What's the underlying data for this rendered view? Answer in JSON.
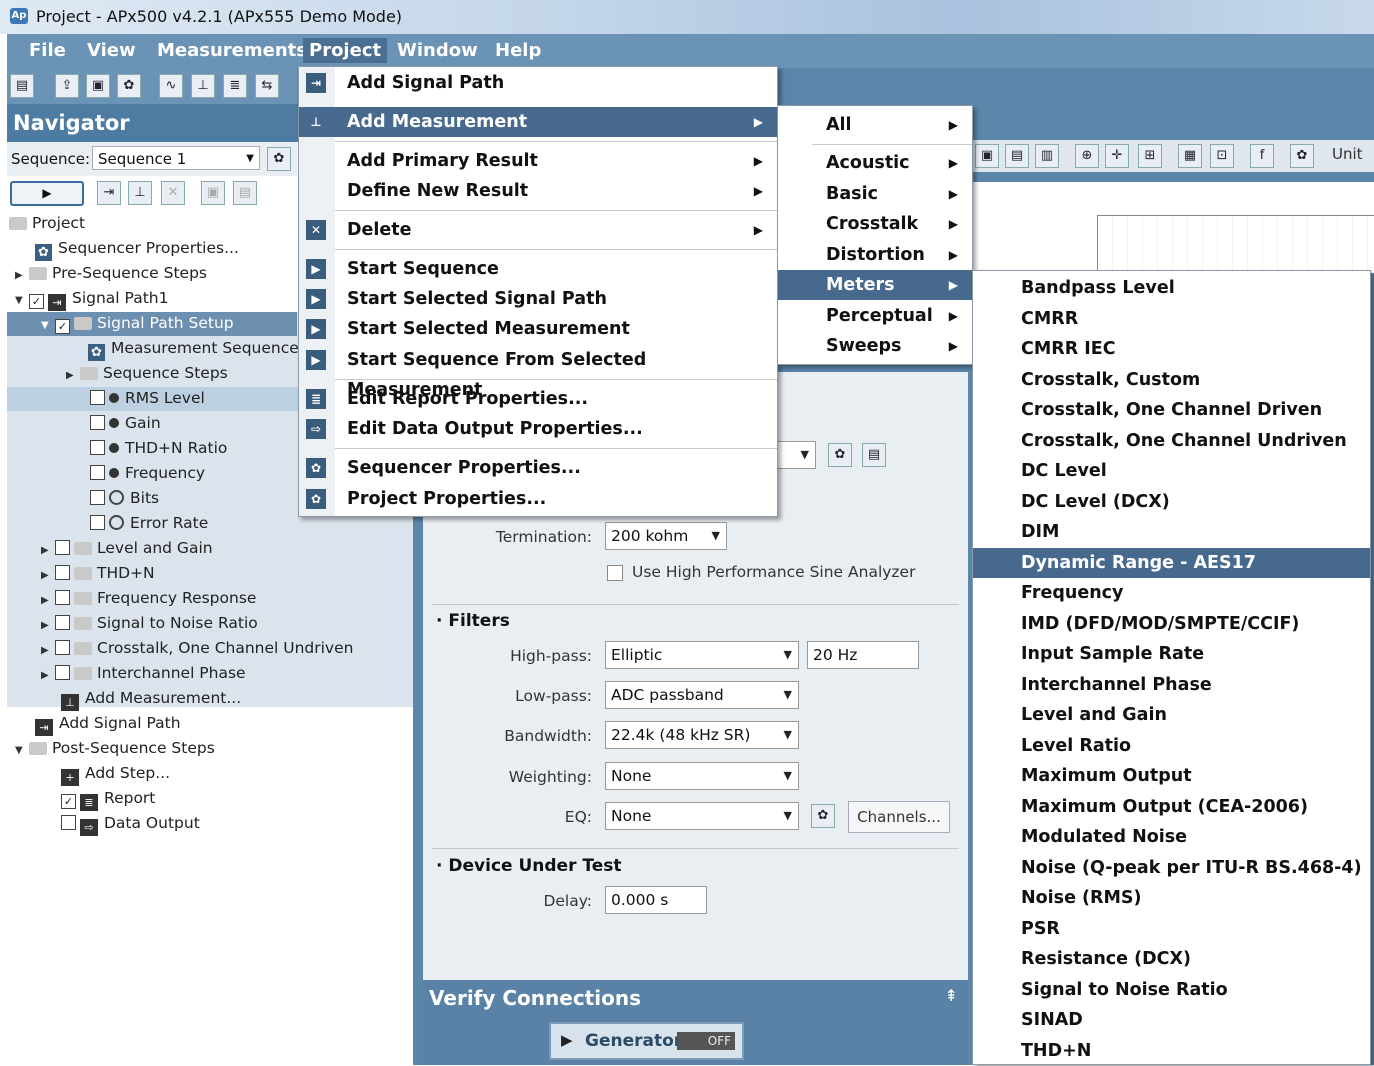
{
  "window": {
    "title": "Project - APx500 v4.2.1 (APx555 Demo Mode)"
  },
  "menubar": {
    "file": "File",
    "view": "View",
    "measurements": "Measurements",
    "project": "Project",
    "window": "Window",
    "help": "Help"
  },
  "navigator": {
    "title": "Navigator",
    "sequence_label": "Sequence:",
    "sequence_value": "Sequence 1",
    "tree": {
      "project": "Project",
      "sequencer_properties": "Sequencer Properties...",
      "pre_sequence_steps": "Pre-Sequence Steps",
      "signal_path1": "Signal Path1",
      "signal_path_setup": "Signal Path Setup",
      "measurement_sequence": "Measurement Sequence S",
      "sequence_steps": "Sequence Steps",
      "rms_level": "RMS Level",
      "gain": "Gain",
      "thdn_ratio": "THD+N Ratio",
      "frequency": "Frequency",
      "bits": "Bits",
      "error_rate": "Error Rate",
      "level_and_gain": "Level and Gain",
      "thdn": "THD+N",
      "frequency_response": "Frequency Response",
      "signal_to_noise": "Signal to Noise Ratio",
      "crosstalk_undriven": "Crosstalk, One Channel Undriven",
      "interchannel_phase": "Interchannel Phase",
      "add_measurement": "Add Measurement...",
      "add_signal_path": "Add Signal Path",
      "post_sequence_steps": "Post-Sequence Steps",
      "add_step": "Add Step...",
      "report": "Report",
      "data_output": "Data Output"
    }
  },
  "project_menu": {
    "add_signal_path": "Add Signal Path",
    "add_measurement": "Add Measurement",
    "add_primary_result": "Add Primary Result",
    "define_new_result": "Define New Result",
    "delete": "Delete",
    "start_sequence": "Start Sequence",
    "start_selected_signal_path": "Start Selected Signal Path",
    "start_selected_measurement": "Start Selected Measurement",
    "start_sequence_from_selected": "Start Sequence From Selected Measurement",
    "edit_report_properties": "Edit Report Properties...",
    "edit_data_output_properties": "Edit Data Output Properties...",
    "sequencer_properties": "Sequencer Properties...",
    "project_properties": "Project Properties..."
  },
  "category_menu": [
    "All",
    "Acoustic",
    "Basic",
    "Crosstalk",
    "Distortion",
    "Meters",
    "Perceptual",
    "Sweeps"
  ],
  "meters_menu": [
    "Bandpass Level",
    "CMRR",
    "CMRR IEC",
    "Crosstalk, Custom",
    "Crosstalk, One Channel Driven",
    "Crosstalk, One Channel Undriven",
    "DC Level",
    "DC Level (DCX)",
    "DIM",
    "Dynamic Range - AES17",
    "Frequency",
    "IMD (DFD/MOD/SMPTE/CCIF)",
    "Input Sample Rate",
    "Interchannel Phase",
    "Level and Gain",
    "Level Ratio",
    "Maximum Output",
    "Maximum Output (CEA-2006)",
    "Modulated Noise",
    "Noise (Q-peak per ITU-R BS.468-4)",
    "Noise (RMS)",
    "PSR",
    "Resistance (DCX)",
    "Signal to Noise Ratio",
    "SINAD",
    "THD+N"
  ],
  "settings": {
    "termination_label": "Termination:",
    "termination_value": "200 kohm",
    "high_perf_label": "Use High Performance Sine Analyzer",
    "filters_title": "Filters",
    "highpass_label": "High-pass:",
    "highpass_value": "Elliptic",
    "highpass_freq": "20 Hz",
    "lowpass_label": "Low-pass:",
    "lowpass_value": "ADC passband",
    "bandwidth_label": "Bandwidth:",
    "bandwidth_value": "22.4k (48 kHz SR)",
    "weighting_label": "Weighting:",
    "weighting_value": "None",
    "eq_label": "EQ:",
    "eq_value": "None",
    "channels_button": "Channels...",
    "dut_title": "Device Under Test",
    "delay_label": "Delay:",
    "delay_value": "0.000 s"
  },
  "verify": {
    "title": "Verify Connections",
    "generator_label": "Generator",
    "generator_state": "OFF"
  },
  "graph_toolbar": {
    "unit_label": "Unit"
  },
  "colors": {
    "menu_highlight": "#46698d",
    "app_blue": "#5b86aa",
    "panel_bg": "#e9eef3"
  }
}
